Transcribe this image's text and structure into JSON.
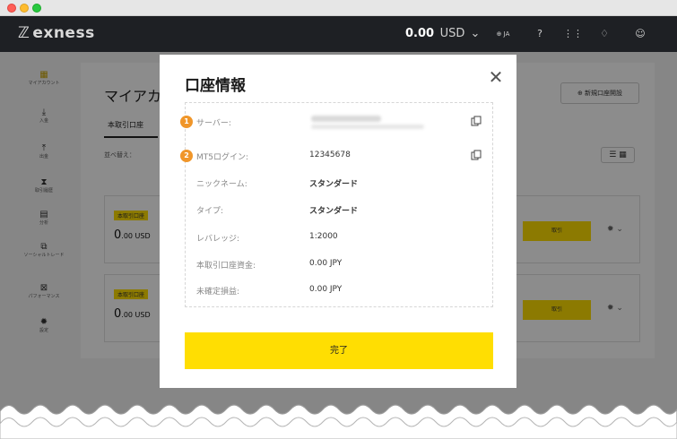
{
  "header": {
    "logo_text": "exness",
    "balance": "0.00",
    "currency": "USD",
    "language": "JA"
  },
  "background": {
    "title": "マイアカウ",
    "new_account_label": "新規口座開設",
    "tab_real": "本取引口座",
    "sort_label": "並べ替え：",
    "accounts": [
      {
        "tag": "本取引口座",
        "balance_int": "0",
        "balance_dec": ".00 USD",
        "trade_label": "取引"
      },
      {
        "tag": "本取引口座",
        "balance_int": "0",
        "balance_dec": ".00 USD",
        "trade_label": "取引"
      }
    ],
    "sidebar": [
      {
        "label": "マイアカウント",
        "icon": "grid-icon"
      },
      {
        "label": "入金",
        "icon": "download-icon"
      },
      {
        "label": "出金",
        "icon": "upload-icon"
      },
      {
        "label": "取引履歴",
        "icon": "hourglass-icon"
      },
      {
        "label": "分析",
        "icon": "chart-icon"
      },
      {
        "label": "ソーシャルトレード",
        "icon": "copy-icon"
      },
      {
        "label": "パフォーマンス",
        "icon": "performance-icon"
      },
      {
        "label": "設定",
        "icon": "gear-icon"
      }
    ]
  },
  "modal": {
    "title": "口座情報",
    "rows": [
      {
        "badge": "1",
        "label": "サーバー:",
        "value": "",
        "copy": true
      },
      {
        "badge": "2",
        "label": "MT5ログイン:",
        "value": "12345678",
        "copy": true
      },
      {
        "badge": "",
        "label": "ニックネーム:",
        "value": "スタンダード",
        "copy": false
      },
      {
        "badge": "",
        "label": "タイプ:",
        "value": "スタンダード",
        "copy": false
      },
      {
        "badge": "",
        "label": "レバレッジ:",
        "value": "1:2000",
        "copy": false
      },
      {
        "badge": "",
        "label": "本取引口座資金:",
        "value": "0.00 JPY",
        "copy": false
      },
      {
        "badge": "",
        "label": "未確定損益:",
        "value": "0.00 JPY",
        "copy": false
      }
    ],
    "done_label": "完了"
  },
  "colors": {
    "accent": "#ffde02",
    "badge": "#f0962a",
    "header_bg": "#1e2024"
  }
}
